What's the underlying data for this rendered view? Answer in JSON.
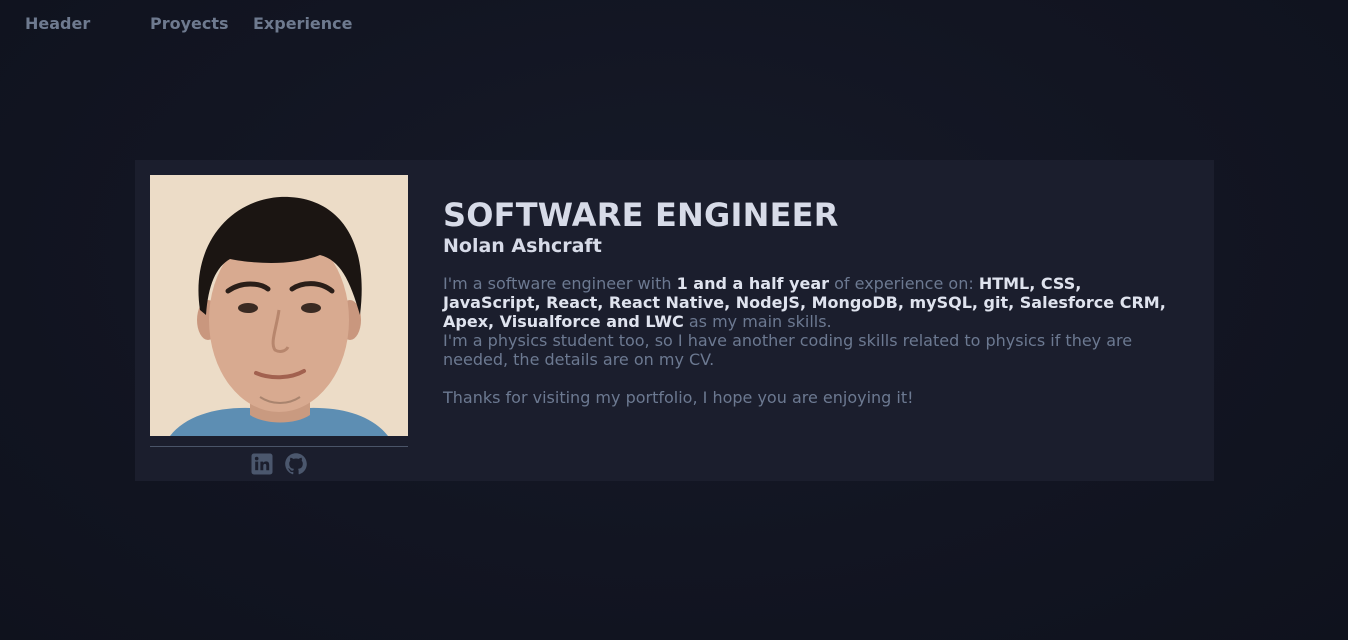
{
  "nav": {
    "items": [
      {
        "label": "Header"
      },
      {
        "label": "Proyects"
      },
      {
        "label": "Experience"
      }
    ]
  },
  "profile": {
    "title": "SOFTWARE ENGINEER",
    "name": "Nolan Ashcraft",
    "photo_alt": "profile-photo",
    "bio": {
      "p1_a": "I'm a software engineer with ",
      "p1_b": "1 and a half year",
      "p1_c": " of experience on: ",
      "p1_d": "HTML, CSS, JavaScript, React, React Native, NodeJS, MongoDB, mySQL, git, Salesforce CRM, Apex, Visualforce and LWC",
      "p1_e": " as my main skills.",
      "p2": "I'm a physics student too, so I have another coding skills related to physics if they are needed, the details are on my CV.",
      "p3": "Thanks for visiting my portfolio, I hope you are enjoying it!"
    },
    "socials": [
      {
        "icon": "linkedin-icon"
      },
      {
        "icon": "github-icon"
      }
    ]
  },
  "colors": {
    "background": "#121522",
    "card": "#1b1e2d",
    "heading": "#d7dbe8",
    "muted_text": "#6c7991",
    "nav_text": "#6e7a8f"
  }
}
